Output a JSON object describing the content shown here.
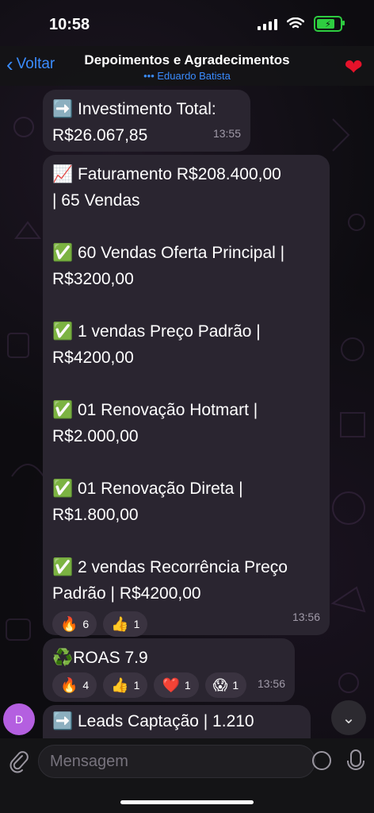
{
  "status": {
    "time": "10:58"
  },
  "nav": {
    "back_label": "Voltar",
    "title": "Depoimentos e Agradecimentos",
    "subtitle": "••• Eduardo Batista"
  },
  "messages": [
    {
      "lines": [
        "➡️ Investimento Total:",
        "R$26.067,85"
      ],
      "time": "13:55"
    },
    {
      "lines": [
        "📈 Faturamento R$208.400,00",
        "| 65 Vendas",
        "",
        "✅ 60 Vendas Oferta Principal |",
        "R$3200,00",
        "",
        "✅ 1 vendas Preço Padrão  |",
        "R$4200,00",
        "",
        "✅ 01 Renovação Hotmart |",
        "R$2.000,00",
        "",
        "✅ 01 Renovação Direta |",
        "R$1.800,00",
        "",
        "✅ 2 vendas Recorrência Preço",
        "Padrão | R$4200,00"
      ],
      "reactions": [
        {
          "icon": "fire-emoji",
          "glyph": "🔥",
          "count": "6"
        },
        {
          "icon": "thumbs-up-emoji",
          "glyph": "👍",
          "count": "1"
        }
      ],
      "time": "13:56"
    },
    {
      "lines": [
        "♻️ROAS 7.9"
      ],
      "reactions": [
        {
          "icon": "fire-emoji",
          "glyph": "🔥",
          "count": "4"
        },
        {
          "icon": "thumbs-up-emoji",
          "glyph": "👍",
          "count": "1"
        },
        {
          "icon": "heart-emoji",
          "glyph": "❤️",
          "count": "1"
        },
        {
          "icon": "scream-emoji",
          "glyph": "😱",
          "count": "1"
        }
      ],
      "time": "13:56"
    },
    {
      "lines": [
        "➡️ Leads Captação | 1.210"
      ]
    }
  ],
  "avatar": {
    "initial": "D",
    "color": "#b45fe0"
  },
  "composer": {
    "placeholder": "Mensagem"
  },
  "colors": {
    "accent": "#3a8cff",
    "bubble": "#2a2530",
    "heart": "#e5122a"
  }
}
